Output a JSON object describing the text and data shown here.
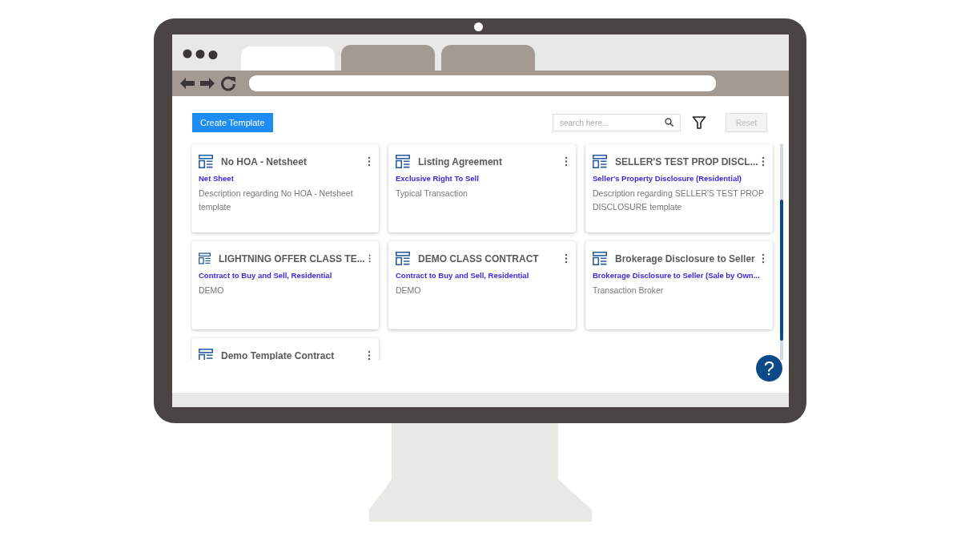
{
  "browser": {
    "tabs": [
      {
        "selected": true
      },
      {
        "selected": false
      },
      {
        "selected": false
      }
    ]
  },
  "toolbar": {
    "create_button": "Create Template",
    "search": {
      "placeholder": "search here..."
    },
    "reset_button": {
      "label": "Reset",
      "disabled": true
    }
  },
  "cards": [
    {
      "title": "No HOA - Netsheet",
      "form": "Net Sheet",
      "description": "Description regarding No HOA - Netsheet template"
    },
    {
      "title": "Listing Agreement",
      "form": "Exclusive Right To Sell",
      "description": "Typical Transaction"
    },
    {
      "title": "SELLER'S TEST PROP DISCL...",
      "form": "Seller's Property Disclosure (Residential)",
      "description": "Description regarding SELLER'S TEST PROP DISCLOSURE template"
    },
    {
      "title": "LIGHTNING OFFER CLASS TE...",
      "form": "Contract to Buy and Sell, Residential",
      "description": "DEMO"
    },
    {
      "title": "DEMO CLASS CONTRACT",
      "form": "Contract to Buy and Sell, Residential",
      "description": "DEMO"
    },
    {
      "title": "Brokerage Disclosure to Seller",
      "form": "Brokerage Disclosure to Seller (Sale by Own...",
      "description": "Transaction Broker"
    },
    {
      "title": "Demo Template Contract"
    }
  ],
  "help_button": "?"
}
